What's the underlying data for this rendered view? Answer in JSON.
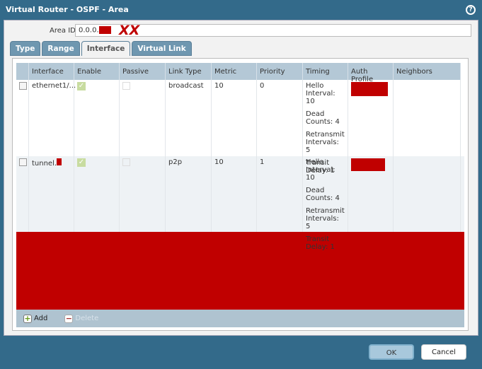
{
  "window": {
    "title": "Virtual Router - OSPF - Area",
    "help_icon": "help-icon"
  },
  "area_id": {
    "label": "Area ID",
    "value": "0.0.0.",
    "annotation": "XX"
  },
  "tabs": [
    {
      "label": "Type"
    },
    {
      "label": "Range"
    },
    {
      "label": "Interface",
      "active": true
    },
    {
      "label": "Virtual Link"
    }
  ],
  "table": {
    "columns": [
      "Interface",
      "Enable",
      "Passive",
      "Link Type",
      "Metric",
      "Priority",
      "Timing",
      "Auth Profile",
      "Neighbors"
    ],
    "rows": [
      {
        "interface": "ethernet1/...",
        "enable": true,
        "passive": false,
        "link_type": "broadcast",
        "metric": "10",
        "priority": "0",
        "timing": [
          "Hello Interval: 10",
          "Dead Counts: 4",
          "Retransmit Intervals: 5",
          "Transit Delay: 1"
        ]
      },
      {
        "interface": "tunnel.",
        "enable": true,
        "passive": false,
        "link_type": "p2p",
        "metric": "10",
        "priority": "1",
        "timing": [
          "Hello Interval: 10",
          "Dead Counts: 4",
          "Retransmit Intervals: 5",
          "Transit Delay: 1"
        ]
      }
    ]
  },
  "footer": {
    "add": "Add",
    "delete": "Delete"
  },
  "buttons": {
    "ok": "OK",
    "cancel": "Cancel"
  },
  "colors": {
    "frame": "#336a8a",
    "header": "#b4c8d6",
    "redaction": "#c00000"
  }
}
